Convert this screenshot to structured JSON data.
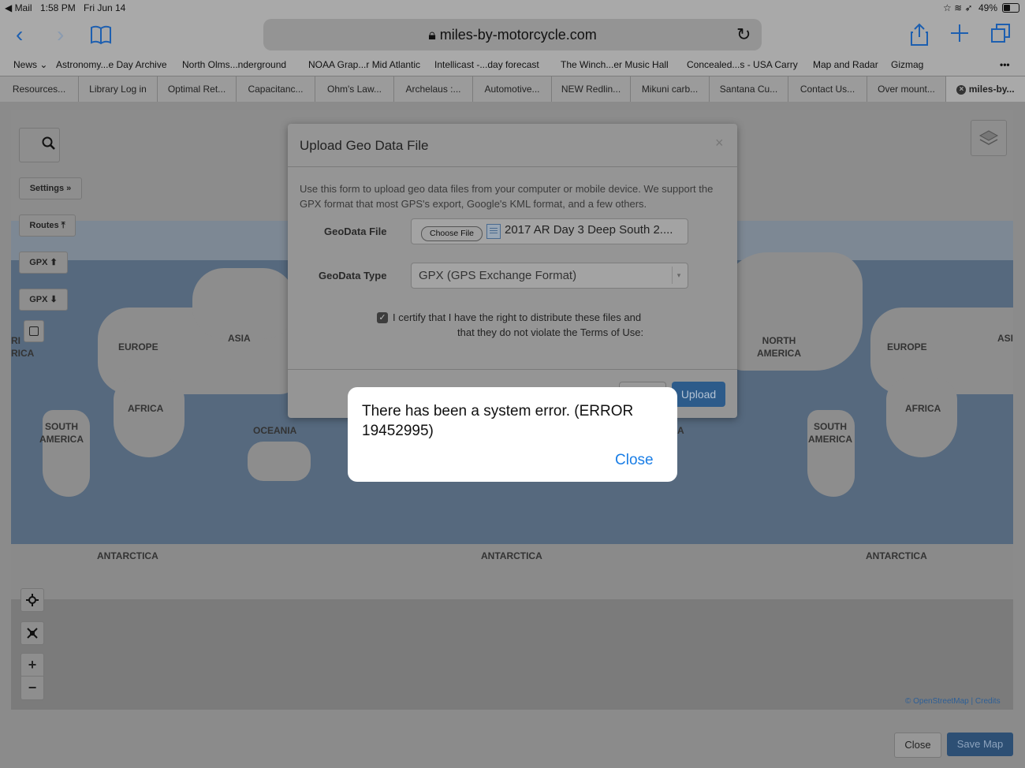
{
  "status_bar": {
    "back_app": "◀ Mail",
    "time": "1:58 PM",
    "date": "Fri Jun 14",
    "battery": "49%",
    "battery_level": 0.49
  },
  "nav": {
    "url": "miles-by-motorcycle.com"
  },
  "bookmarks": [
    "News ⌄",
    "Astronomy...e Day Archive",
    "North Olms...nderground",
    "NOAA Grap...r Mid Atlantic",
    "Intellicast -...day forecast",
    "The Winch...er Music Hall",
    "Concealed...s - USA Carry",
    "Map and Radar",
    "Gizmag"
  ],
  "tabs": [
    "Resources...",
    "Library Log in",
    "Optimal Ret...",
    "Capacitanc...",
    "Ohm's Law...",
    "Archelaus :...",
    "Automotive...",
    "NEW Redlin...",
    "Mikuni carb...",
    "Santana Cu...",
    "Contact Us...",
    "Over mount...",
    "miles-by..."
  ],
  "map": {
    "controls": {
      "settings": "Settings »",
      "routes": "Routes ⤒",
      "gpx_upload": "GPX ⬆",
      "gpx_download": "GPX ⬇",
      "zoom_in": "+",
      "zoom_out": "−"
    },
    "labels": {
      "europe_left": "EUROPE",
      "asia_left": "ASIA",
      "africa_left": "AFRICA",
      "south_america_left": "SOUTH\nAMERICA",
      "oceania": "OCEANIA",
      "antarctica_left": "ANTARCTICA",
      "antarctica_mid": "ANTARCTICA",
      "antarctica_right": "ANTARCTICA",
      "north_america_right": "NORTH\nAMERICA",
      "europe_right": "EUROPE",
      "africa_right": "AFRICA",
      "south_america_right": "SOUTH\nAMERICA",
      "asia_right": "ASI",
      "america_cut": "RI\nRICA",
      "a_cut": "A"
    },
    "attribution": "© OpenStreetMap | Credits"
  },
  "upload_dialog": {
    "title": "Upload Geo Data File",
    "close": "×",
    "description": "Use this form to upload geo data files from your computer or mobile device. We support the GPX format that most GPS's export, Google's KML format, and a few others.",
    "geodata_file_label": "GeoData File",
    "choose_file": "Choose File",
    "file_name": "2017 AR Day 3 Deep South 2....",
    "geodata_type_label": "GeoData Type",
    "geodata_type_value": "GPX (GPS Exchange Format)",
    "certify_line1": "I certify that I have the right to distribute these files and",
    "certify_line2": "that they do not violate the Terms of Use:",
    "upload_button": "Upload"
  },
  "alert": {
    "message": "There has been a system error. (ERROR 19452995)",
    "close": "Close"
  },
  "footer": {
    "close": "Close",
    "save_map": "Save Map"
  }
}
